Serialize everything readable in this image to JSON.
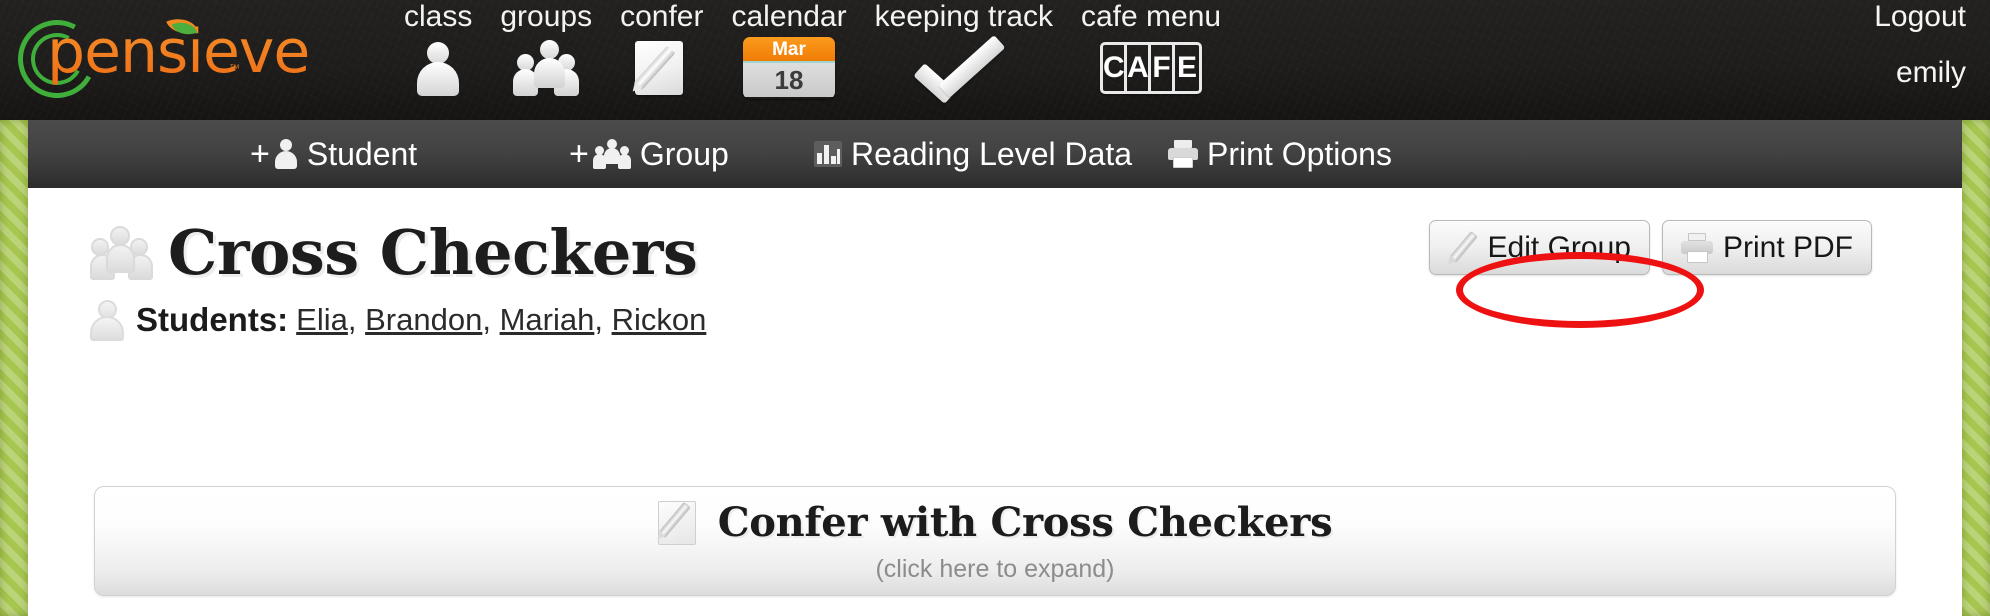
{
  "brand": {
    "name": "pensieve",
    "trademark": "™",
    "accent_orange": "#f07c1b",
    "accent_green": "#3fae3a"
  },
  "header": {
    "nav": [
      {
        "label": "class",
        "icon": "person-icon"
      },
      {
        "label": "groups",
        "icon": "group-icon"
      },
      {
        "label": "confer",
        "icon": "note-pencil-icon"
      },
      {
        "label": "calendar",
        "icon": "calendar-icon",
        "month": "Mar",
        "day": "18"
      },
      {
        "label": "keeping track",
        "icon": "check-icon"
      },
      {
        "label": "cafe menu",
        "icon": "cafe-icon",
        "letters": [
          "C",
          "A",
          "F",
          "E"
        ]
      }
    ],
    "account": {
      "logout_label": "Logout",
      "username": "emily"
    }
  },
  "toolbar": {
    "items": [
      {
        "label": "Student",
        "prefix": "+",
        "icon": "add-student-icon"
      },
      {
        "label": "Group",
        "prefix": "+",
        "icon": "add-group-icon"
      },
      {
        "label": "Reading Level Data",
        "prefix": "",
        "icon": "bar-chart-icon"
      },
      {
        "label": "Print Options",
        "prefix": "",
        "icon": "printer-icon"
      }
    ]
  },
  "main": {
    "group_title": "Cross Checkers",
    "students_label": "Students:",
    "students": [
      "Elia",
      "Brandon",
      "Mariah",
      "Rickon"
    ],
    "students_separator": ", ",
    "buttons": {
      "edit_group": "Edit Group",
      "print_pdf": "Print PDF"
    },
    "confer": {
      "title": "Confer with Cross Checkers",
      "subtitle": "(click here to expand)"
    }
  },
  "annotation": {
    "target": "Edit Group",
    "color": "#ee1111",
    "shape": "ellipse"
  }
}
